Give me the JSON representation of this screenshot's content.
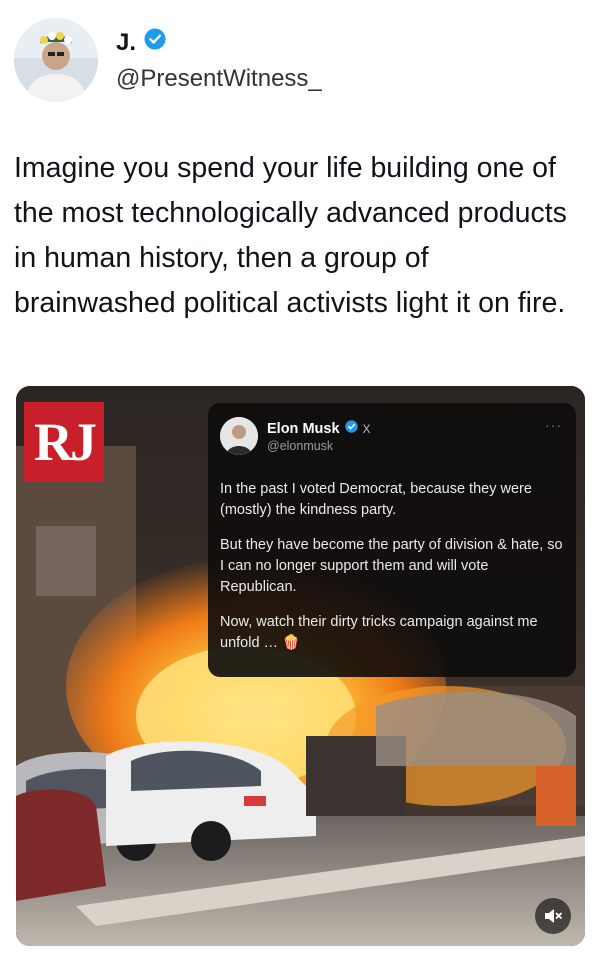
{
  "author": {
    "display_name": "J.",
    "handle": "@PresentWitness_",
    "verified_icon": "verified-badge-icon",
    "avatar_icon": "profile-avatar"
  },
  "tweet": {
    "text": "Imagine you spend your life building one of the most technologically advanced products in human history, then a group of brainwashed political activists light it on fire."
  },
  "media": {
    "logo_text": "RJ",
    "embedded_post": {
      "display_name": "Elon Musk",
      "handle": "@elonmusk",
      "platform_mark": "X",
      "menu_glyph": "···",
      "paragraphs": [
        "In the past I voted Democrat, because they were (mostly) the kindness party.",
        "But they have become the party of division & hate, so I can no longer support them and will vote Republican.",
        "Now, watch their dirty tricks campaign against me unfold … 🍿"
      ]
    },
    "mute_icon": "mute-icon"
  },
  "colors": {
    "verified": "#1d9bf0",
    "rj_red": "#c8202b",
    "text": "#0f1419",
    "handle": "#333333"
  }
}
